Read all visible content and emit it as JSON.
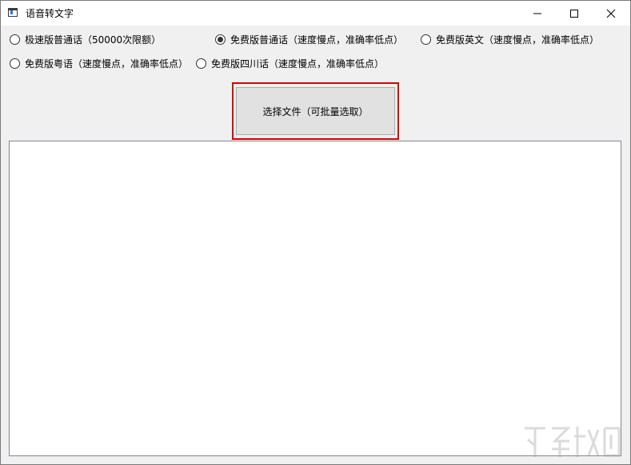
{
  "window": {
    "title": "语音转文字",
    "icon": "app-window-icon",
    "controls": [
      "minimize-icon",
      "maximize-icon",
      "close-icon"
    ]
  },
  "options": [
    {
      "label": "极速版普通话（50000次限额）",
      "checked": false
    },
    {
      "label": "免费版普通话（速度慢点，准确率低点）",
      "checked": true
    },
    {
      "label": "免费版英文（速度慢点，准确率低点）",
      "checked": false
    },
    {
      "label": "免费版粤语（速度慢点，准确率低点）",
      "checked": false
    },
    {
      "label": "免费版四川话（速度慢点，准确率低点）",
      "checked": false
    }
  ],
  "select_button": {
    "label": "选择文件（可批量选取）"
  },
  "output_box": {
    "content": ""
  },
  "colors": {
    "highlight": "#d80000",
    "accent": "#333333"
  }
}
